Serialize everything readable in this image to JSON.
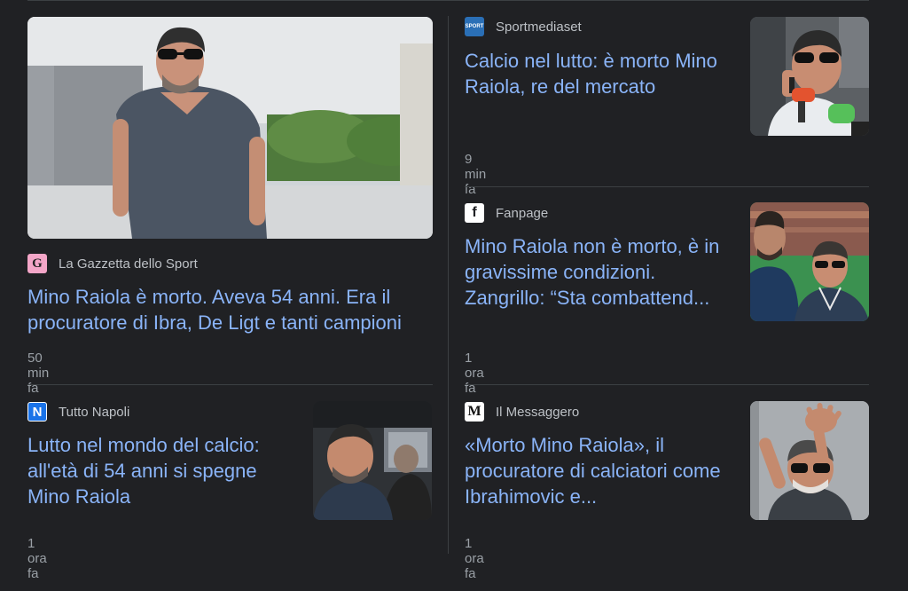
{
  "articles": [
    {
      "source": "La Gazzetta dello Sport",
      "favicon": "gazzetta-logo-icon",
      "favicon_letter": "G",
      "headline": "Mino Raiola è morto. Aveva 54 anni. Era il procuratore di Ibra, De Ligt e tanti campioni",
      "time": "50 min fa"
    },
    {
      "source": "Sportmediaset",
      "favicon": "sportmediaset-logo-icon",
      "favicon_letter": "SPORT",
      "headline": "Calcio nel lutto: è morto Mino Raiola, re del mercato",
      "time": "9 min fa"
    },
    {
      "source": "Fanpage",
      "favicon": "fanpage-logo-icon",
      "favicon_letter": "f",
      "headline": "Mino Raiola non è morto, è in gravissime condizioni. Zangrillo: “Sta combattend...",
      "time": "1 ora fa"
    },
    {
      "source": "Tutto Napoli",
      "favicon": "tuttonapoli-logo-icon",
      "favicon_letter": "N",
      "headline": "Lutto nel mondo del calcio: all'età di 54 anni si spegne Mino Raiola",
      "time": "1 ora fa"
    },
    {
      "source": "Il Messaggero",
      "favicon": "messaggero-logo-icon",
      "favicon_letter": "M",
      "headline": "«Morto Mino Raiola», il procuratore di calciatori come Ibrahimovic e...",
      "time": "1 ora fa"
    }
  ],
  "colors": {
    "background": "#202124",
    "headline": "#8ab4f8",
    "source": "#bdc1c6",
    "time": "#9aa0a6",
    "divider": "#3c4043"
  }
}
